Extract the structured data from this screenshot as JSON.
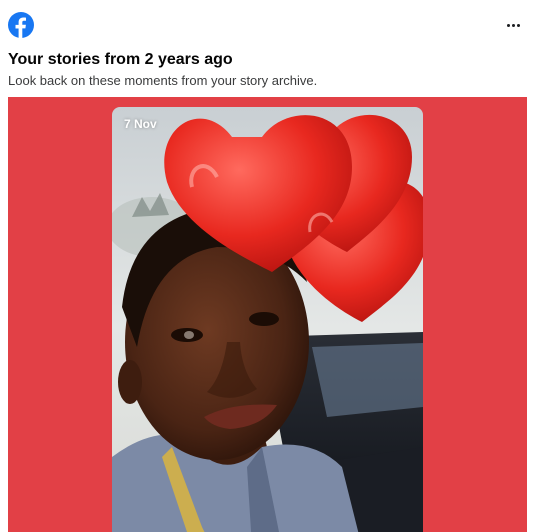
{
  "header": {
    "logo_icon": "facebook-logo-icon",
    "more_icon": "more-options-icon",
    "brand_color": "#1877f2"
  },
  "post": {
    "title": "Your stories from 2 years ago",
    "subtitle": "Look back on these moments from your story archive."
  },
  "story": {
    "date": "7 Nov",
    "background_color": "#e24046",
    "sticker_icon": "hearts-sticker-icon"
  }
}
